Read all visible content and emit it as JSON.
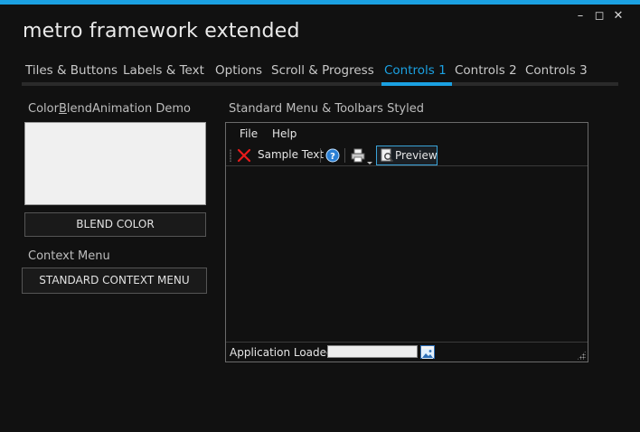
{
  "window": {
    "title": "metro framework extended",
    "controls": {
      "minimize": "–",
      "maximize": "◻",
      "close": "✕"
    }
  },
  "tabs": [
    {
      "label": "Tiles & Buttons"
    },
    {
      "label": "Labels & Text"
    },
    {
      "label": "Options"
    },
    {
      "label": "Scroll & Progress"
    },
    {
      "label": "Controls 1"
    },
    {
      "label": "Controls 2"
    },
    {
      "label": "Controls 3"
    }
  ],
  "active_tab": "Controls 1",
  "left_panel": {
    "color_blend_label_pre": "Color",
    "color_blend_label_mnemonic": "B",
    "color_blend_label_post": "lendAnimation Demo",
    "blend_button": "BLEND COLOR",
    "context_menu_label": "Context Menu",
    "context_menu_button": "STANDARD CONTEXT MENU"
  },
  "right_panel": {
    "label": "Standard Menu & Toolbars Styled",
    "menu": [
      {
        "label": "File"
      },
      {
        "label": "Help"
      }
    ],
    "toolbar": {
      "sample_text": "Sample Text",
      "preview": "Preview"
    },
    "status": {
      "text": "Application Loaded"
    }
  },
  "colors": {
    "accent": "#1ba1e2",
    "background": "#111111"
  }
}
